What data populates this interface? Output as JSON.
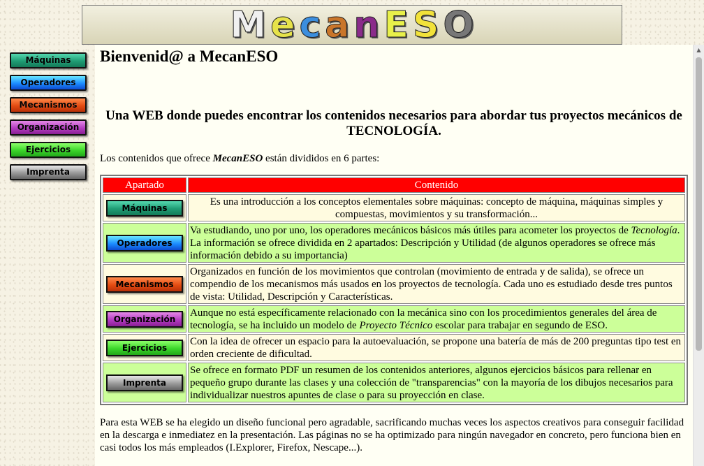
{
  "banner": {
    "letters": [
      {
        "char": "M",
        "color": "#f0f0f0"
      },
      {
        "char": "e",
        "color": "#e6e24a"
      },
      {
        "char": "c",
        "color": "#3b8ede"
      },
      {
        "char": "a",
        "color": "#c9752a"
      },
      {
        "char": "n",
        "color": "#8a2b8a"
      },
      {
        "char": "E",
        "color": "#e8f04a"
      },
      {
        "char": "S",
        "color": "#f2e23a"
      },
      {
        "char": "O",
        "color": "#777777"
      }
    ],
    "alt": "MecanESO"
  },
  "nav": {
    "items": [
      {
        "label": "Máquinas"
      },
      {
        "label": "Operadores"
      },
      {
        "label": "Mecanismos"
      },
      {
        "label": "Organización"
      },
      {
        "label": "Ejercicios"
      },
      {
        "label": "Imprenta"
      }
    ]
  },
  "main": {
    "title": "Bienvenid@ a MecanESO",
    "subtitle": "Una WEB donde puedes encontrar los contenidos necesarios para abordar tus proyectos mecánicos de TECNOLOGÍA.",
    "intro_before": "Los contenidos que ofrece ",
    "intro_brand": "MecanESO",
    "intro_after": " están divididos en 6 partes:",
    "table": {
      "headers": [
        "Apartado",
        "Contenido"
      ],
      "rows": [
        {
          "button": "Máquinas",
          "text": "Es una introducción a los conceptos elementales sobre máquinas: concepto de máquina, máquinas simples y compuestas, movimientos y su transformación..."
        },
        {
          "button": "Operadores",
          "text_a": "Va estudiando, uno por uno, los operadores mecánicos básicos más útiles para acometer los proyectos de ",
          "text_em": "Tecnología",
          "text_b": ". La información se ofrece dividida en 2 apartados: Descripción y Utilidad (de algunos operadores se ofrece más información debido a su importancia)"
        },
        {
          "button": "Mecanismos",
          "text": "Organizados en función de los movimientos que controlan (movimiento de entrada y de salida), se ofrece un compendio de los mecanismos más usados en los proyectos de tecnología. Cada uno es estudiado desde tres puntos de vista: Utilidad, Descripción y Características."
        },
        {
          "button": "Organización",
          "text_a": "Aunque no está específicamente relacionado con la mecánica sino con los procedimientos generales del área de tecnología, se ha incluido un modelo de ",
          "text_em": "Proyecto Técnico",
          "text_b": " escolar para trabajar en segundo de ESO."
        },
        {
          "button": "Ejercicios",
          "text": "Con la idea de ofrecer un espacio para la autoevaluación, se propone una batería de más de 200 preguntas tipo test en orden creciente de dificultad."
        },
        {
          "button": "Imprenta",
          "text": "Se ofrece en formato PDF un resumen de los contenidos anteriores, algunos ejercicios básicos para rellenar en pequeño grupo durante las clases y una colección de \"transparencias\" con la mayoría de los dibujos necesarios para individualizar nuestros apuntes de clase o para su proyección en clase."
        }
      ]
    },
    "outro": "Para esta WEB se ha elegido un diseño funcional pero agradable, sacrificando muchas veces los aspectos creativos para conseguir facilidad en la descarga e inmediatez en la presentación. Las páginas no se ha optimizado para ningún navegador en concreto, pero funciona bien en casi todos los más empleados (I.Explorer, Firefox, Nescape...)."
  },
  "scrollbar": {
    "up_arrow": "▲"
  }
}
